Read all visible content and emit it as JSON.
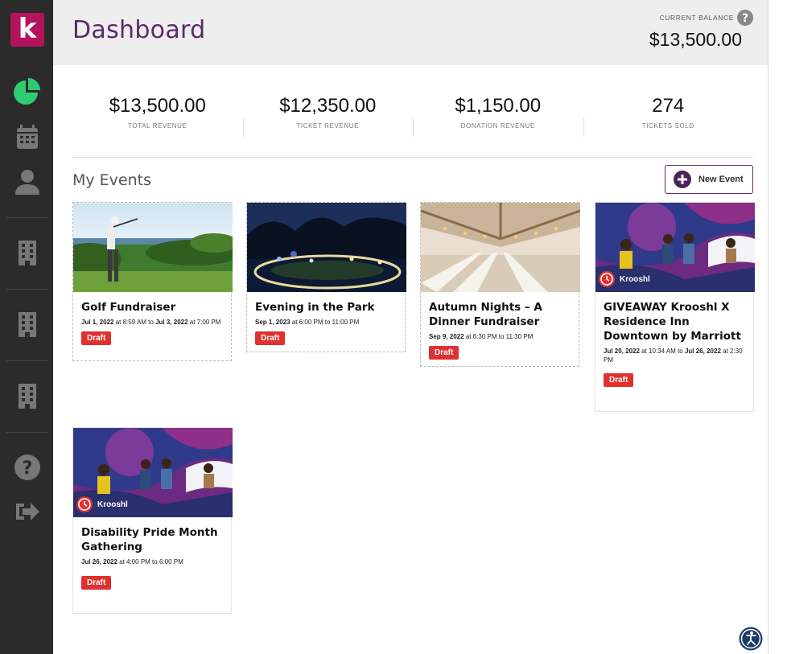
{
  "app": {
    "logo_letter": "k",
    "brand_color": "#b3135d"
  },
  "sidebar": {
    "items": [
      {
        "icon": "pie-chart-icon",
        "active": true
      },
      {
        "icon": "calendar-icon"
      },
      {
        "icon": "user-icon"
      },
      {
        "icon": "building-icon"
      },
      {
        "icon": "building-icon"
      },
      {
        "icon": "building-icon"
      },
      {
        "icon": "help-icon"
      },
      {
        "icon": "logout-icon"
      }
    ]
  },
  "header": {
    "title": "Dashboard",
    "balance_label": "CURRENT BALANCE",
    "balance_value": "$13,500.00"
  },
  "stats": [
    {
      "value": "$13,500.00",
      "label": "TOTAL REVENUE"
    },
    {
      "value": "$12,350.00",
      "label": "TICKET REVENUE"
    },
    {
      "value": "$1,150.00",
      "label": "DONATION REVENUE"
    },
    {
      "value": "274",
      "label": "TICKETS SOLD"
    }
  ],
  "events": {
    "section_title": "My Events",
    "new_event_label": "New Event",
    "cards": [
      {
        "title": "Golf Fundraiser",
        "start": "Jul 1, 2022",
        "start_time": " at 8:59 AM to ",
        "end": "Jul 3, 2022",
        "end_time": " at 7:00 PM",
        "status": "Draft"
      },
      {
        "title": "Evening in the Park",
        "start": "Sep 1, 2023",
        "start_time": " at 6:00 PM to 11:00 PM",
        "end": "",
        "end_time": "",
        "status": "Draft"
      },
      {
        "title": "Autumn Nights – A Dinner Fundraiser",
        "start": "Sep 9, 2022",
        "start_time": " at 6:30 PM to 11:30 PM",
        "end": "",
        "end_time": "",
        "status": "Draft"
      },
      {
        "title": "GIVEAWAY Krooshl X Residence Inn Downtown by Marriott",
        "start": "Jul 20, 2022",
        "start_time": " at 10:34 AM to ",
        "end": "Jul 26, 2022",
        "end_time": " at 2:30 PM",
        "status": "Draft",
        "badge": "Krooshl"
      },
      {
        "title": "Disability Pride Month Gathering",
        "start": "Jul 26, 2022",
        "start_time": " at 4:00 PM to 6:00 PM",
        "end": "",
        "end_time": "",
        "status": "Draft",
        "badge": "Krooshl"
      }
    ]
  },
  "colors": {
    "accent": "#5c2a6e",
    "draft": "#e03030",
    "active_icon": "#2ecc71"
  }
}
